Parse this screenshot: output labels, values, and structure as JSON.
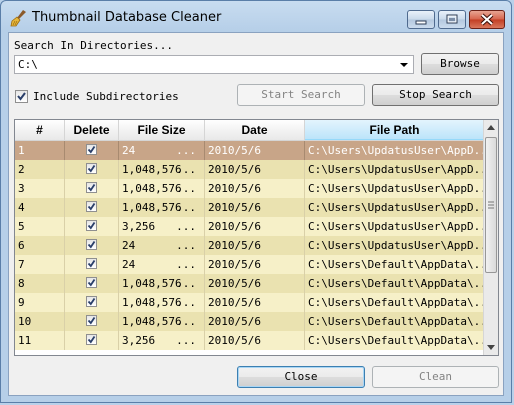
{
  "window": {
    "title": "Thumbnail Database Cleaner"
  },
  "search": {
    "label": "Search In Directories...",
    "path_value": "C:\\",
    "browse_label": "Browse",
    "include_subdirs_label": "Include Subdirectories",
    "include_subdirs_checked": true,
    "start_search_label": "Start Search",
    "start_search_enabled": false,
    "stop_search_label": "Stop Search"
  },
  "table": {
    "columns": [
      "#",
      "Delete",
      "File Size",
      "Date",
      "File Path"
    ],
    "rows": [
      {
        "num": "1",
        "checked": true,
        "size": "24",
        "date": "2010/5/6",
        "path": "C:\\Users\\UpdatusUser\\AppD...",
        "selected": true
      },
      {
        "num": "2",
        "checked": true,
        "size": "1,048,576",
        "date": "2010/5/6",
        "path": "C:\\Users\\UpdatusUser\\AppD..."
      },
      {
        "num": "3",
        "checked": true,
        "size": "1,048,576",
        "date": "2010/5/6",
        "path": "C:\\Users\\UpdatusUser\\AppD..."
      },
      {
        "num": "4",
        "checked": true,
        "size": "1,048,576",
        "date": "2010/5/6",
        "path": "C:\\Users\\UpdatusUser\\AppD..."
      },
      {
        "num": "5",
        "checked": true,
        "size": "3,256",
        "date": "2010/5/6",
        "path": "C:\\Users\\UpdatusUser\\AppD..."
      },
      {
        "num": "6",
        "checked": true,
        "size": "24",
        "date": "2010/5/6",
        "path": "C:\\Users\\UpdatusUser\\AppD..."
      },
      {
        "num": "7",
        "checked": true,
        "size": "24",
        "date": "2010/5/6",
        "path": "C:\\Users\\Default\\AppData\\..."
      },
      {
        "num": "8",
        "checked": true,
        "size": "1,048,576",
        "date": "2010/5/6",
        "path": "C:\\Users\\Default\\AppData\\..."
      },
      {
        "num": "9",
        "checked": true,
        "size": "1,048,576",
        "date": "2010/5/6",
        "path": "C:\\Users\\Default\\AppData\\..."
      },
      {
        "num": "10",
        "checked": true,
        "size": "1,048,576",
        "date": "2010/5/6",
        "path": "C:\\Users\\Default\\AppData\\..."
      },
      {
        "num": "11",
        "checked": true,
        "size": "3,256",
        "date": "2010/5/6",
        "path": "C:\\Users\\Default\\AppData\\..."
      }
    ],
    "size_suffix": "...",
    "row_colors": {
      "odd": "#f6f0c8",
      "even": "#eae2b0",
      "selected": "#c8a588"
    }
  },
  "footer": {
    "close_label": "Close",
    "clean_label": "Clean",
    "clean_enabled": false
  },
  "icons": {
    "app": "broom-icon",
    "minimize": "minimize-icon",
    "maximize": "maximize-icon",
    "close": "close-icon",
    "dropdown": "chevron-down-icon",
    "check": "checkmark-icon",
    "scroll_up": "arrow-up-icon",
    "scroll_down": "arrow-down-icon"
  }
}
